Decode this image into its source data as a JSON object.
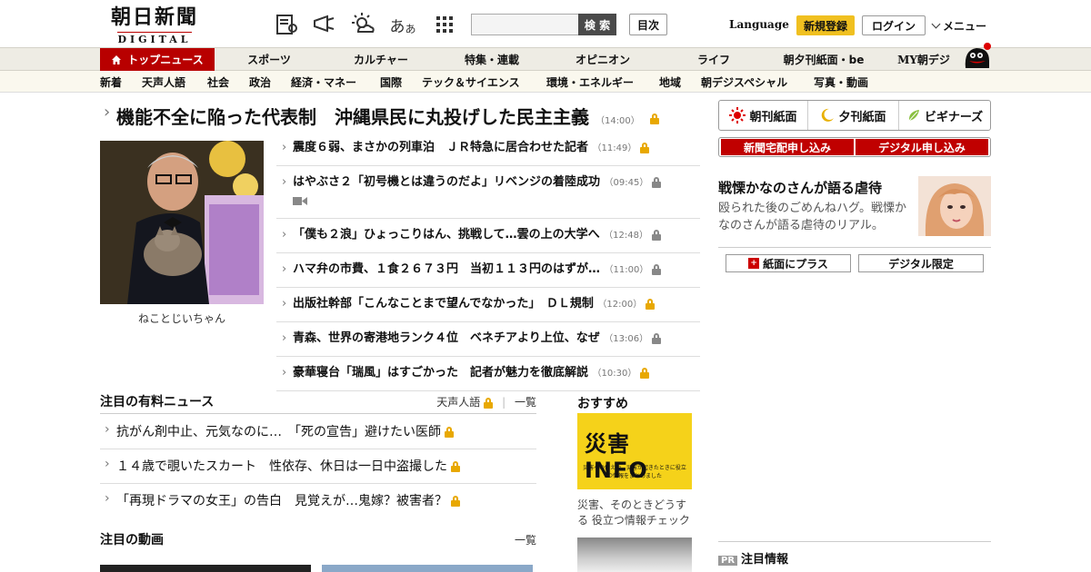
{
  "brand": {
    "name_ja": "朝日新聞",
    "name_en": "DIGITAL"
  },
  "header": {
    "search_button": "検 索",
    "search_placeholder": "",
    "mokuji": "目次",
    "language": "Language",
    "signup": "新規登録",
    "login": "ログイン",
    "menu": "メニュー"
  },
  "main_nav": {
    "top_news": "トップニュース",
    "items": [
      "スポーツ",
      "カルチャー",
      "特集・連載",
      "オピニオン",
      "ライフ",
      "朝夕刊紙面・be",
      "MY朝デジ"
    ]
  },
  "sub_nav": [
    "新着",
    "天声人語",
    "社会",
    "政治",
    "経済・マネー",
    "国際",
    "テック＆サイエンス",
    "環境・エネルギー",
    "地域",
    "朝デジスペシャル",
    "写真・動画"
  ],
  "headline": {
    "title": "機能不全に陥った代表制　沖縄県民に丸投げした民主主義",
    "time": "（14:00）"
  },
  "photo_caption": "ねことじいちゃん",
  "articles": [
    {
      "title": "震度６弱、まさかの列車泊　ＪＲ特急に居合わせた記者",
      "time": "（11:49）",
      "lock": "gold"
    },
    {
      "title": "はやぶさ２「初号機とは違うのだよ」リベンジの着陸成功",
      "time": "（09:45）",
      "lock": "gray"
    },
    {
      "title": "「僕も２浪」ひょっこりはん、挑戦して…雲の上の大学へ",
      "time": "（12:48）",
      "lock": "gray"
    },
    {
      "title": "ハマ弁の市費、１食２６７３円　当初１１３円のはずが…",
      "time": "（11:00）",
      "lock": "gray"
    },
    {
      "title": "出版社幹部「こんなことまで望んでなかった」　ＤＬ規制",
      "time": "（12:00）",
      "lock": "gold"
    },
    {
      "title": "青森、世界の寄港地ランク４位　ベネチアより上位、なぜ",
      "time": "（13:06）",
      "lock": "gray"
    },
    {
      "title": "豪華寝台「瑞風」はすごかった　記者が魅力を徹底解説",
      "time": "（10:30）",
      "lock": "gold"
    }
  ],
  "right": {
    "papers": [
      "朝刊紙面",
      "夕刊紙面",
      "ビギナーズ"
    ],
    "applies": [
      "新聞宅配申し込み",
      "デジタル申し込み"
    ],
    "feature_title": "戦慄かなのさんが語る虐待",
    "feature_text": "殴られた後のごめんねハグ。戦慄かなのさんが語る虐待のリアル。",
    "plus_buttons": [
      "紙面にプラス",
      "デジタル限定"
    ],
    "pr_label": "PR",
    "notice": "注目情報"
  },
  "paid_news": {
    "title": "注目の有料ニュース",
    "link1": "天声人語",
    "link2": "一覧",
    "items": [
      "抗がん剤中止、元気なのに…　「死の宣告」避けたい医師",
      "１４歳で覗いたスカート　性依存、休日は一日中盗撮した",
      "「再現ドラマの女王」の告白　見覚えが…鬼嫁？被害者？"
    ]
  },
  "videos": {
    "title": "注目の動画",
    "link": "一覧"
  },
  "recommend": {
    "title": "おすすめ",
    "banner_big": "災害INFO",
    "banner_small": "災害への備えや、災害が起きたときに役立つ情報をまとめました",
    "caption": "災害、そのときどうする 役立つ情報チェック"
  }
}
